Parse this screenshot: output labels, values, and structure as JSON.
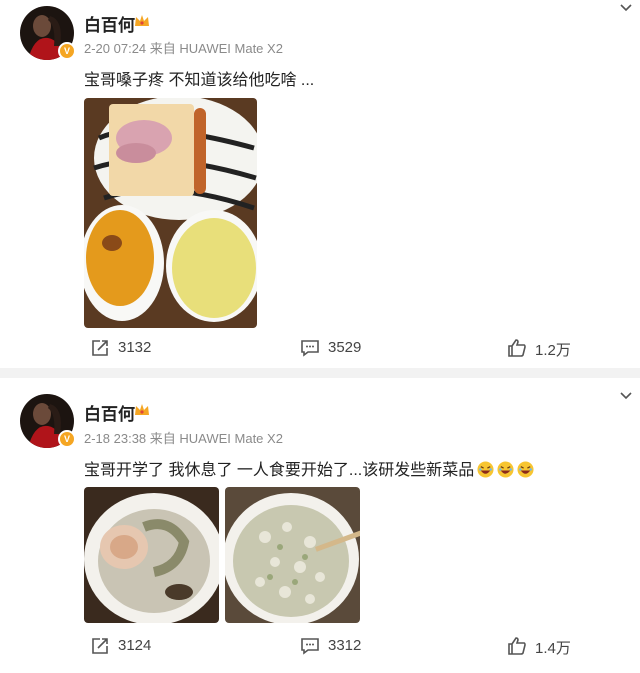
{
  "posts": [
    {
      "username": "白百何",
      "meta": "2-20 07:24  来自 HUAWEI Mate X2",
      "content": "宝哥嗓子疼  不知道该给他吃啥 ...",
      "repost_count": "3132",
      "comment_count": "3529",
      "like_count": "1.2万"
    },
    {
      "username": "白百何",
      "meta": "2-18 23:38  来自 HUAWEI Mate X2",
      "content": "宝哥开学了  我休息了  一人食要开始了...该研发些新菜品",
      "repost_count": "3124",
      "comment_count": "3312",
      "like_count": "1.4万"
    }
  ],
  "icons": {
    "verified": "verified-badge-icon",
    "vip": "crown-icon",
    "more": "chevron-down-icon",
    "repost": "repost-icon",
    "comment": "comment-icon",
    "like": "thumbs-up-icon",
    "emoji": "laughing-emoji-icon"
  },
  "colors": {
    "badge": "#f5a623",
    "meta_text": "#8a8a8a",
    "divider": "#f2f2f2"
  }
}
